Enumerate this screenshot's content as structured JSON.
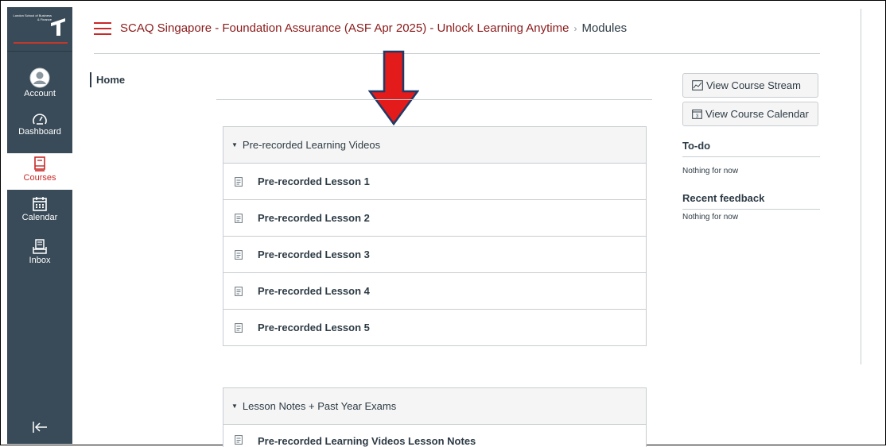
{
  "global_nav": {
    "logo_text": "London School of Business & Finance",
    "items": [
      {
        "label": "Account",
        "icon": "account-avatar-icon"
      },
      {
        "label": "Dashboard",
        "icon": "dashboard-gauge-icon"
      },
      {
        "label": "Courses",
        "icon": "courses-book-icon",
        "active": true
      },
      {
        "label": "Calendar",
        "icon": "calendar-icon"
      },
      {
        "label": "Inbox",
        "icon": "inbox-icon"
      }
    ],
    "collapse_icon": "collapse-nav-icon"
  },
  "header": {
    "course_link": "SCAQ Singapore - Foundation Assurance (ASF Apr 2025) - Unlock Learning Anytime",
    "separator": "›",
    "current_page": "Modules"
  },
  "course_nav": {
    "home": "Home"
  },
  "modules": [
    {
      "title": "Pre-recorded Learning Videos",
      "items": [
        "Pre-recorded Lesson 1",
        "Pre-recorded Lesson 2",
        "Pre-recorded Lesson 3",
        "Pre-recorded Lesson 4",
        "Pre-recorded Lesson 5"
      ]
    },
    {
      "title": "Lesson Notes + Past Year Exams",
      "items": [
        "Pre-recorded Learning Videos Lesson Notes"
      ]
    }
  ],
  "sidebar": {
    "view_stream": "View Course Stream",
    "view_calendar": "View Course Calendar",
    "todo_heading": "To-do",
    "todo_text": "Nothing for now",
    "feedback_heading": "Recent feedback",
    "feedback_text": "Nothing for now"
  },
  "colors": {
    "nav_bg": "#394b58",
    "brand_red": "#c82828",
    "arrow_fill": "#e41b1b",
    "arrow_stroke": "#1f3a66"
  }
}
